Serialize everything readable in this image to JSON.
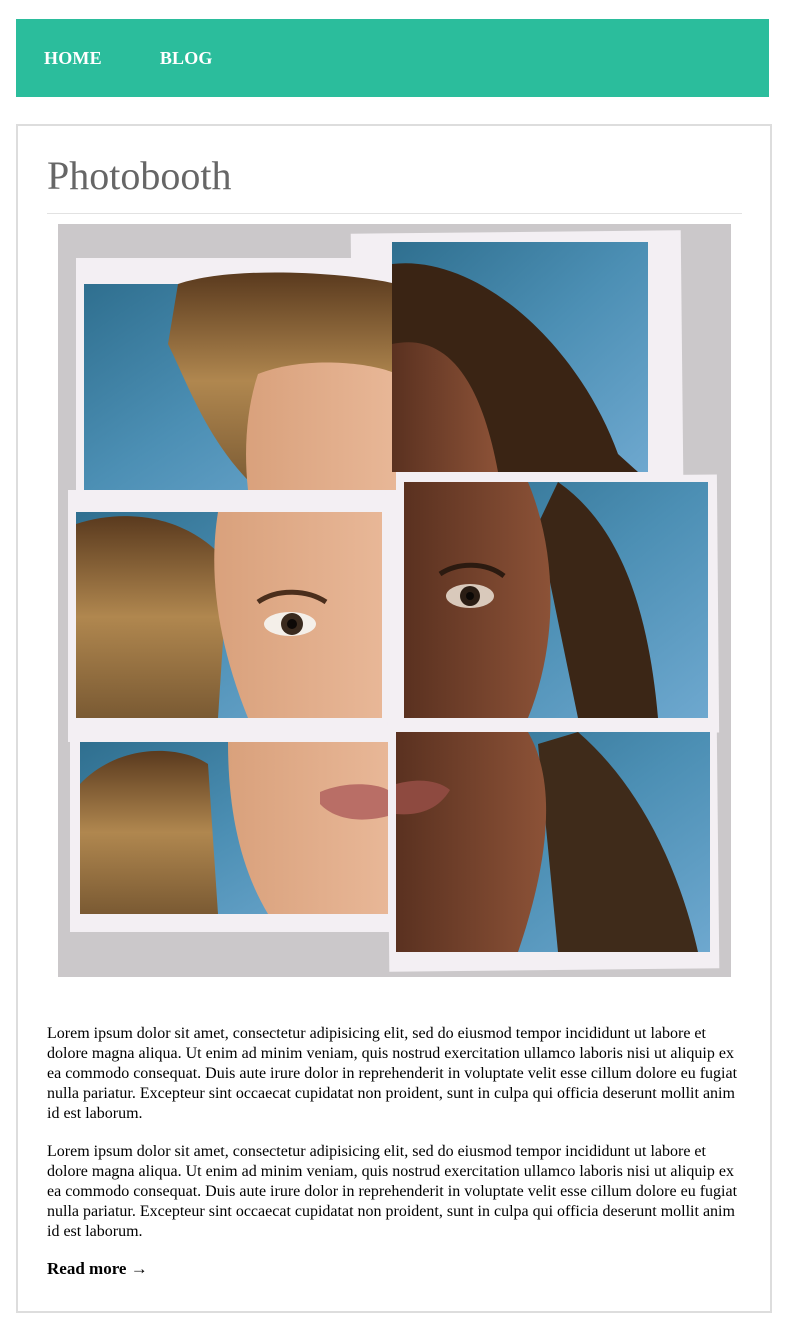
{
  "nav": {
    "items": [
      {
        "label": "HOME"
      },
      {
        "label": "BLOG"
      }
    ]
  },
  "colors": {
    "nav_bg": "#2bbd9c",
    "title": "#666666",
    "card_border": "#dddddd"
  },
  "post": {
    "title": "Photobooth",
    "image": {
      "subject": "collage of six polaroid-style prints of a woman's face"
    },
    "paragraphs": [
      "Lorem ipsum dolor sit amet, consectetur adipisicing elit, sed do eiusmod tempor incididunt ut labore et dolore magna aliqua. Ut enim ad minim veniam, quis nostrud exercitation ullamco laboris nisi ut aliquip ex ea commodo consequat. Duis aute irure dolor in reprehenderit in voluptate velit esse cillum dolore eu fugiat nulla pariatur. Excepteur sint occaecat cupidatat non proident, sunt in culpa qui officia deserunt mollit anim id est laborum.",
      "Lorem ipsum dolor sit amet, consectetur adipisicing elit, sed do eiusmod tempor incididunt ut labore et dolore magna aliqua. Ut enim ad minim veniam, quis nostrud exercitation ullamco laboris nisi ut aliquip ex ea commodo consequat. Duis aute irure dolor in reprehenderit in voluptate velit esse cillum dolore eu fugiat nulla pariatur. Excepteur sint occaecat cupidatat non proident, sunt in culpa qui officia deserunt mollit anim id est laborum."
    ],
    "read_more": "Read more →"
  }
}
